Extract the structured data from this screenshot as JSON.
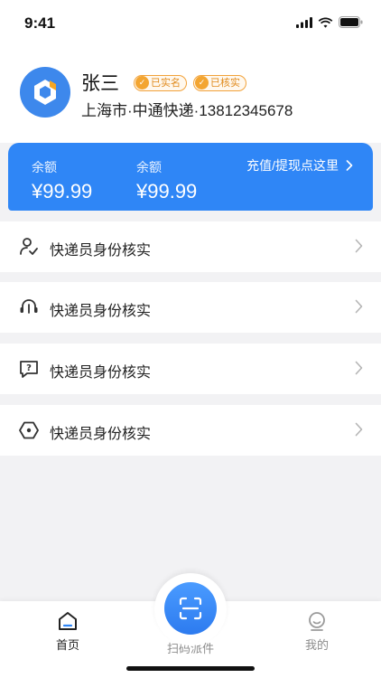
{
  "status_bar": {
    "time": "9:41"
  },
  "profile": {
    "name": "张三",
    "badges": [
      {
        "label": "已实名"
      },
      {
        "label": "已核实"
      }
    ],
    "subtitle": "上海市·中通快递·13812345678"
  },
  "balance": {
    "items": [
      {
        "label": "余额",
        "value": "¥99.99"
      },
      {
        "label": "余额",
        "value": "¥99.99"
      }
    ],
    "action_label": "充值/提现点这里"
  },
  "menu": {
    "items": [
      {
        "label": "快递员身份核实",
        "icon": "user-check-icon"
      },
      {
        "label": "快递员身份核实",
        "icon": "headset-icon"
      },
      {
        "label": "快递员身份核实",
        "icon": "help-message-icon"
      },
      {
        "label": "快递员身份核实",
        "icon": "hexagon-icon"
      }
    ]
  },
  "tabbar": {
    "tabs": [
      {
        "label": "首页",
        "active": true
      },
      {
        "label": "扫码派件",
        "active": false
      },
      {
        "label": "我的",
        "active": false
      }
    ]
  },
  "colors": {
    "accent": "#2f86f6",
    "badge": "#f2a23a",
    "background": "#f2f2f4"
  }
}
